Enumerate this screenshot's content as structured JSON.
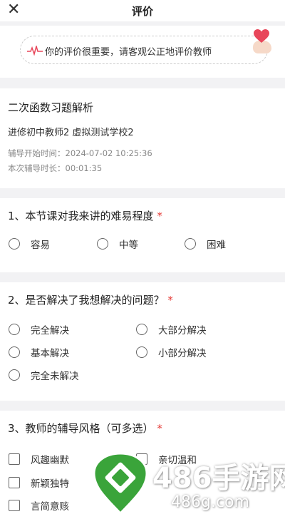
{
  "header": {
    "title": "评价",
    "close_icon": "close-icon"
  },
  "banner": {
    "text": "你的评价很重要，请客观公正地评价教师"
  },
  "course": {
    "title": "二次函数习题解析",
    "teacher": "进修初中教师2 虚拟测试学校2",
    "start_time": "辅导开始时间：2024-07-02 10:25:36",
    "duration": "本次辅导时长：00:01:35"
  },
  "questions": [
    {
      "title": "1、本节课对我来讲的难易程度",
      "required": "*",
      "type": "radio",
      "options": [
        "容易",
        "中等",
        "困难"
      ]
    },
    {
      "title": "2、是否解决了我想解决的问题？",
      "required": "*",
      "type": "radio",
      "options": [
        "完全解决",
        "大部分解决",
        "基本解决",
        "小部分解决",
        "完全未解决"
      ]
    },
    {
      "title": "3、教师的辅导风格（可多选）",
      "required": "*",
      "type": "checkbox",
      "options": [
        "风趣幽默",
        "亲切温和",
        "新颖独特",
        "言简意赅"
      ]
    }
  ],
  "watermark": {
    "big": "486手游网",
    "small": "486g.com"
  },
  "colors": {
    "required": "#e53935",
    "brand_green": "#3aa43a",
    "heart": "#e8465a"
  }
}
